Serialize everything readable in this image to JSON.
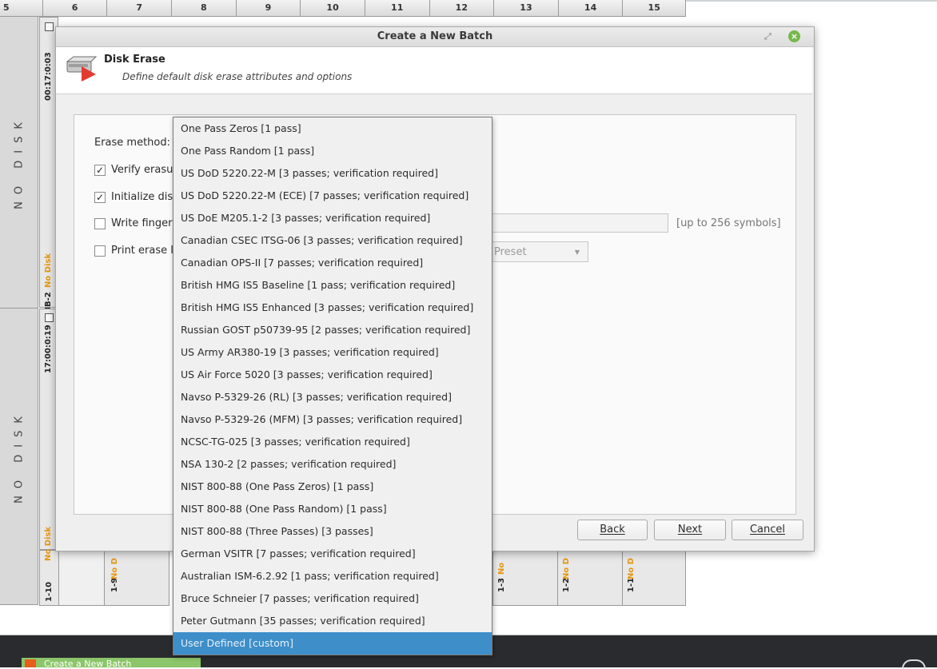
{
  "grid": {
    "columns": [
      "5",
      "6",
      "7",
      "8",
      "9",
      "10",
      "11",
      "12",
      "13",
      "14",
      "15"
    ],
    "row_labels": [
      "NO DISK",
      "NO DISK"
    ],
    "upper_bay": {
      "time": "00:17:0:03",
      "id": "MB-2",
      "status": "No Disk"
    },
    "lower_bay": {
      "time": "17:00:0:19"
    },
    "bottom_bays": [
      {
        "id": "1-10",
        "status": "No Disk"
      },
      {
        "id": "1-9",
        "status": "No D"
      },
      {
        "id": "1-3",
        "status": "No"
      },
      {
        "id": "1-2",
        "status": "No D"
      },
      {
        "id": "1-1",
        "status": "No D"
      }
    ]
  },
  "dialog": {
    "title": "Create a New Batch",
    "header_title": "Disk Erase",
    "header_subtitle": "Define default disk erase attributes and options",
    "erase_method_label": "Erase method:",
    "options": [
      {
        "label": "Verify erasu",
        "checked": true
      },
      {
        "label": "Initialize disl",
        "checked": true
      },
      {
        "label": "Write fingerp",
        "checked": false
      },
      {
        "label": "Print erase l",
        "checked": false
      }
    ],
    "check_mark": "✓",
    "fingerprint_hint": "[up to 256 symbols]",
    "preset_value": "Preset",
    "buttons": {
      "back": "Back",
      "next": "Next",
      "cancel": "Cancel"
    }
  },
  "dropdown": {
    "items": [
      "One Pass Zeros [1 pass]",
      "One Pass Random [1 pass]",
      "US DoD 5220.22-M [3 passes; verification required]",
      "US DoD 5220.22-M (ECE) [7 passes; verification required]",
      "US DoE M205.1-2 [3 passes; verification required]",
      "Canadian CSEC ITSG-06 [3 passes; verification required]",
      "Canadian OPS-II [7 passes; verification required]",
      "British HMG IS5 Baseline [1 pass; verification required]",
      "British HMG IS5 Enhanced [3 passes; verification required]",
      "Russian GOST p50739-95 [2 passes; verification required]",
      "US Army AR380-19 [3 passes; verification required]",
      "US Air Force 5020 [3 passes; verification required]",
      "Navso P-5329-26 (RL) [3 passes; verification required]",
      "Navso P-5329-26 (MFM) [3 passes; verification required]",
      "NCSC-TG-025 [3 passes; verification required]",
      "NSA 130-2 [2 passes; verification required]",
      "NIST 800-88 (One Pass Zeros) [1 pass]",
      "NIST 800-88 (One Pass Random) [1 pass]",
      "NIST 800-88 (Three Passes) [3 passes]",
      "German VSITR [7 passes; verification required]",
      "Australian ISM-6.2.92 [1 pass; verification required]",
      "Bruce Schneier [7 passes; verification required]",
      "Peter Gutmann [35 passes; verification required]",
      "User Defined [custom]"
    ],
    "selected_index": 23
  },
  "taskbar": {
    "item_label": "Create a New Batch"
  },
  "colors": {
    "accent": "#3d8ec9",
    "no_disk": "#e8960c",
    "close_button": "#76b84b"
  }
}
